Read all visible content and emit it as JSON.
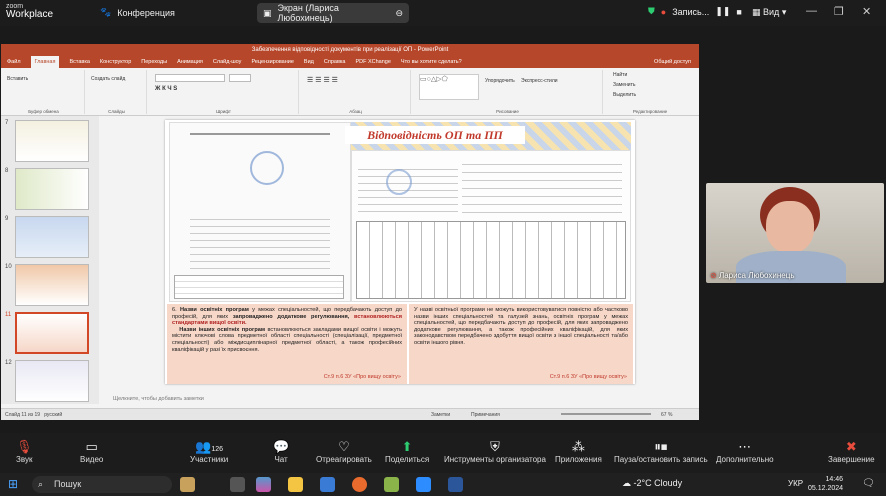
{
  "zoom": {
    "logo_top": "zoom",
    "logo_bottom": "Workplace",
    "conference_label": "Конференция",
    "screen_share_label": "Экран (Лариса Любохинець)",
    "record_label": "Запись...",
    "view_label": "Вид"
  },
  "ppt": {
    "window_title": "Забезпечення відповідності документів при реалізації ОП - PowerPoint",
    "tabs": [
      "Файл",
      "Главная",
      "Вставка",
      "Конструктор",
      "Переходы",
      "Анимация",
      "Слайд-шоу",
      "Рецензирование",
      "Вид",
      "Справка",
      "PDF XChange",
      "Что вы хотите сделать?"
    ],
    "share_label": "Общий доступ",
    "ribbon_groups": [
      "Буфер обмена",
      "Слайды",
      "Шрифт",
      "Абзац",
      "Рисование",
      "Редактирование"
    ],
    "ribbon_items": {
      "paste": "Вставить",
      "create_slide": "Создать слайд",
      "find": "Найти",
      "replace": "Заменить",
      "select": "Выделить",
      "arrange": "Упорядочить",
      "quick_styles": "Экспресс-стили"
    },
    "thumb_numbers": [
      "7",
      "8",
      "9",
      "10",
      "11",
      "12"
    ],
    "notes_placeholder": "Щелкните, чтобы добавить заметки",
    "status": "Слайд 11 из 19",
    "status_lang": "русский",
    "status_notes": "Заметки",
    "status_comments": "Примечания",
    "zoom_level": "67 %"
  },
  "slide": {
    "title": "Відповідність ОП та ПП",
    "left_text": {
      "num": "6.",
      "lead": "Назви освітніх програм",
      "p1": " у межах спеціальностей, що передбачають доступ до професій, для яких ",
      "p1_bold": "запроваджено додаткове регулювання,",
      "p1_red": " встановлюються стандартами вищої освіти.",
      "lead2": "Назви інших освітніх програм",
      "p2": " встановлюються закладами вищої освіти і можуть містити ключові слова предметної області спеціальності (спеціалізації, предметної спеціальності) або міждисциплінарної предметної області, а також професійних кваліфікацій у разі їх присвоєння.",
      "cite": "Ст.9 п.6 ЗУ «Про вищу освіту»"
    },
    "right_text": {
      "p1": "У назві освітньої програми не можуть використовуватися повністю або частково назви інших спеціальностей та галузей знань, освітніх програм у межах спеціальностей, що передбачають доступ до професій, для яких запроваджено додаткове регулювання, а також професійних кваліфікацій, для яких законодавством передбачено здобуття вищої освіти з іншої спеціальності та/або освіти іншого рівня.",
      "cite": "Ст.9 п.6 ЗУ «Про вищу освіту»"
    }
  },
  "webcam": {
    "name": "Лариса Любохинець"
  },
  "toolbar": {
    "items": [
      {
        "label": "Звук",
        "icon": "mic-muted-icon"
      },
      {
        "label": "Видео",
        "icon": "video-icon"
      },
      {
        "label": "Участники",
        "icon": "participants-icon",
        "count": "126"
      },
      {
        "label": "Чат",
        "icon": "chat-icon"
      },
      {
        "label": "Отреагировать",
        "icon": "heart-icon"
      },
      {
        "label": "Поделиться",
        "icon": "share-icon"
      },
      {
        "label": "Инструменты организатора",
        "icon": "shield-icon"
      },
      {
        "label": "Приложения",
        "icon": "apps-icon"
      },
      {
        "label": "Пауза/остановить запись",
        "icon": "pause-icon"
      },
      {
        "label": "Дополнительно",
        "icon": "more-icon"
      },
      {
        "label": "Завершение",
        "icon": "end-icon"
      }
    ]
  },
  "taskbar": {
    "search_label": "Пошук",
    "weather": "-2°C Cloudy",
    "lang": "УКР",
    "time": "14:46",
    "date": "05.12.2024"
  }
}
